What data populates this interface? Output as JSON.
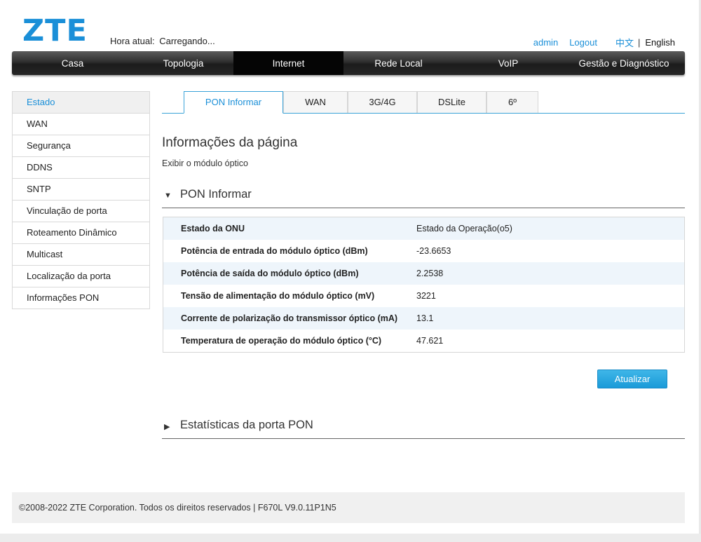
{
  "header": {
    "logo": "ZTE",
    "clock_label": "Hora atual:",
    "clock_value": "Carregando...",
    "user": "admin",
    "logout": "Logout",
    "lang_cn": "中文",
    "lang_sep": "|",
    "lang_en": "English"
  },
  "nav": {
    "items": [
      "Casa",
      "Topologia",
      "Internet",
      "Rede Local",
      "VoIP",
      "Gestão e Diagnóstico"
    ],
    "active": "Internet"
  },
  "sidebar": {
    "items": [
      "Estado",
      "WAN",
      "Segurança",
      "DDNS",
      "SNTP",
      "Vinculação de porta",
      "Roteamento Dinâmico",
      "Multicast",
      "Localização da porta",
      "Informações PON"
    ],
    "active": "Estado"
  },
  "tabs": {
    "items": [
      "PON Informar",
      "WAN",
      "3G/4G",
      "DSLite",
      "6º"
    ],
    "active": "PON Informar"
  },
  "page": {
    "title": "Informações da página",
    "description": "Exibir o módulo óptico"
  },
  "pon_section": {
    "title": "PON Informar",
    "rows": [
      {
        "label": "Estado da ONU",
        "value": "Estado da Operação(o5)"
      },
      {
        "label": "Potência de entrada do módulo óptico (dBm)",
        "value": "-23.6653"
      },
      {
        "label": "Potência de saída do módulo óptico (dBm)",
        "value": "2.2538"
      },
      {
        "label": "Tensão de alimentação do módulo óptico (mV)",
        "value": "3221"
      },
      {
        "label": "Corrente de polarização do transmissor óptico (mA)",
        "value": "13.1"
      },
      {
        "label": "Temperatura de operação do módulo óptico (°C)",
        "value": "47.621"
      }
    ],
    "refresh_button": "Atualizar"
  },
  "stats_section": {
    "title": "Estatísticas da porta PON"
  },
  "footer": {
    "text": "©2008-2022 ZTE Corporation. Todos os direitos reservados | F670L V9.0.11P1N5"
  },
  "colors": {
    "accent": "#1a8fd8",
    "nav_bg": "#2a2a2a",
    "row_alt": "#eef5fb"
  }
}
